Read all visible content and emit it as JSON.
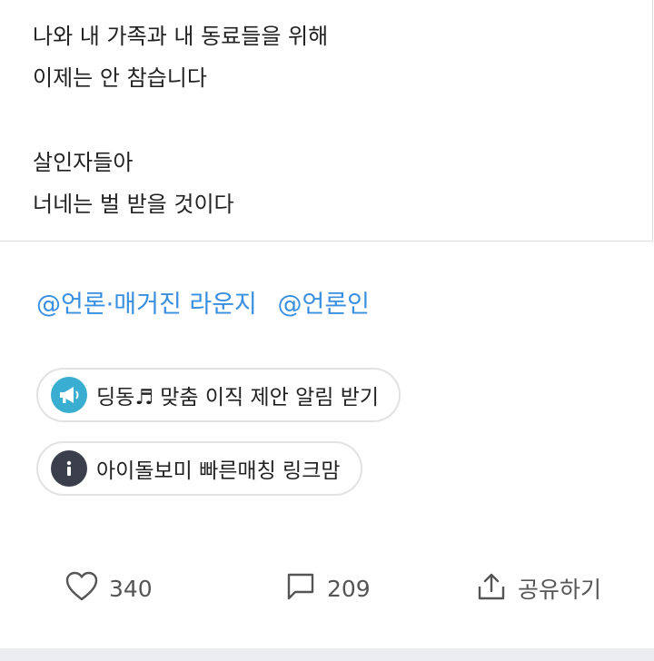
{
  "post": {
    "lines": [
      "나와 내 가족과 내 동료들을 위해",
      "이제는 안 참습니다",
      "살인자들아",
      "너네는 벌 받을 것이다"
    ]
  },
  "tags": [
    "@언론·매거진 라운지",
    "@언론인"
  ],
  "promos": [
    {
      "label": "딩동♬ 맞춤 이직 제안 알림 받기",
      "icon": "megaphone-icon",
      "color": "#3aaed0"
    },
    {
      "label": "아이돌보미 빠른매칭 링크맘",
      "icon": "info-icon",
      "color": "#3a3f4b"
    }
  ],
  "actions": {
    "likes": "340",
    "comments": "209",
    "share": "공유하기"
  }
}
